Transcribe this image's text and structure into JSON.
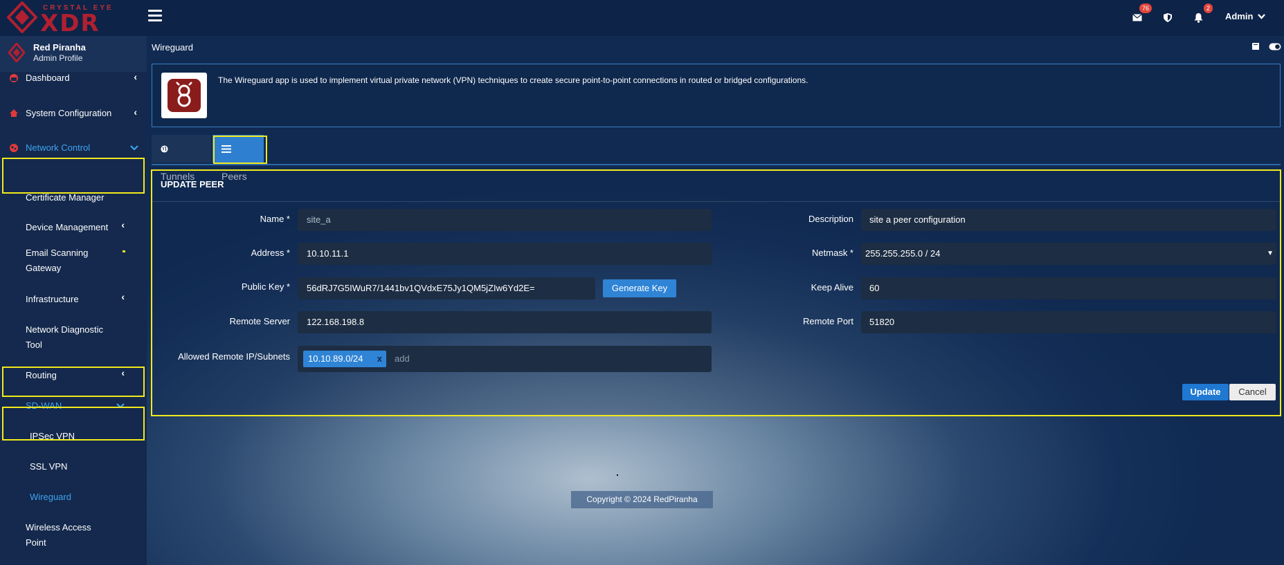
{
  "app": {
    "brand_top": "CRYSTAL EYE",
    "brand_main": "XDR"
  },
  "topbar": {
    "mail_count": "76",
    "alert_count": "2",
    "user_label": "Admin"
  },
  "profile": {
    "name": "Red Piranha",
    "role": "Admin Profile"
  },
  "sidebar": {
    "items": [
      {
        "label": "Dashboard"
      },
      {
        "label": "System Configuration"
      },
      {
        "label": "Network Control"
      },
      {
        "label": "Certificate Manager"
      },
      {
        "label": "Device Management"
      },
      {
        "label": "Email Scanning Gateway"
      },
      {
        "label": "Infrastructure"
      },
      {
        "label": "Network Diagnostic Tool"
      },
      {
        "label": "Routing"
      },
      {
        "label": "SD-WAN"
      },
      {
        "label": "IPSec VPN"
      },
      {
        "label": "SSL VPN"
      },
      {
        "label": "Wireguard"
      },
      {
        "label": "Wireless Access Point"
      }
    ],
    "email_line1": "Email Scanning",
    "email_line2": "Gateway",
    "diag_line1": "Network Diagnostic",
    "diag_line2": "Tool",
    "wap_line1": "Wireless Access",
    "wap_line2": "Point"
  },
  "page": {
    "title": "Wireguard",
    "info_text": "The Wireguard app is used to implement virtual private network (VPN) techniques to create secure point-to-point connections in routed or bridged configurations."
  },
  "tabs": [
    {
      "label": "Tunnels"
    },
    {
      "label": "Peers"
    }
  ],
  "form": {
    "title": "UPDATE PEER",
    "name_label": "Name *",
    "name_value": "site_a",
    "address_label": "Address *",
    "address_value": "10.10.11.1",
    "public_key_label": "Public Key *",
    "public_key_value": "56dRJ7G5IWuR7/1441bv1QVdxE75Jy1QM5jZIw6Yd2E=",
    "generate_key_label": "Generate Key",
    "remote_server_label": "Remote Server",
    "remote_server_value": "122.168.198.8",
    "allowed_label": "Allowed Remote IP/Subnets",
    "allowed_tag": "10.10.89.0/24",
    "allowed_tag_remove": "x",
    "allowed_placeholder": "add",
    "description_label": "Description",
    "description_value": "site a peer configuration",
    "netmask_label": "Netmask *",
    "netmask_value": "255.255.255.0 / 24",
    "keep_alive_label": "Keep Alive",
    "keep_alive_value": "60",
    "remote_port_label": "Remote Port",
    "remote_port_value": "51820",
    "update_label": "Update",
    "cancel_label": "Cancel"
  },
  "footer": {
    "copyright": "Copyright © 2024 RedPiranha"
  },
  "colors": {
    "accent": "#2f84d6",
    "highlight": "#f2ea1c",
    "brand_red": "#b02030"
  }
}
